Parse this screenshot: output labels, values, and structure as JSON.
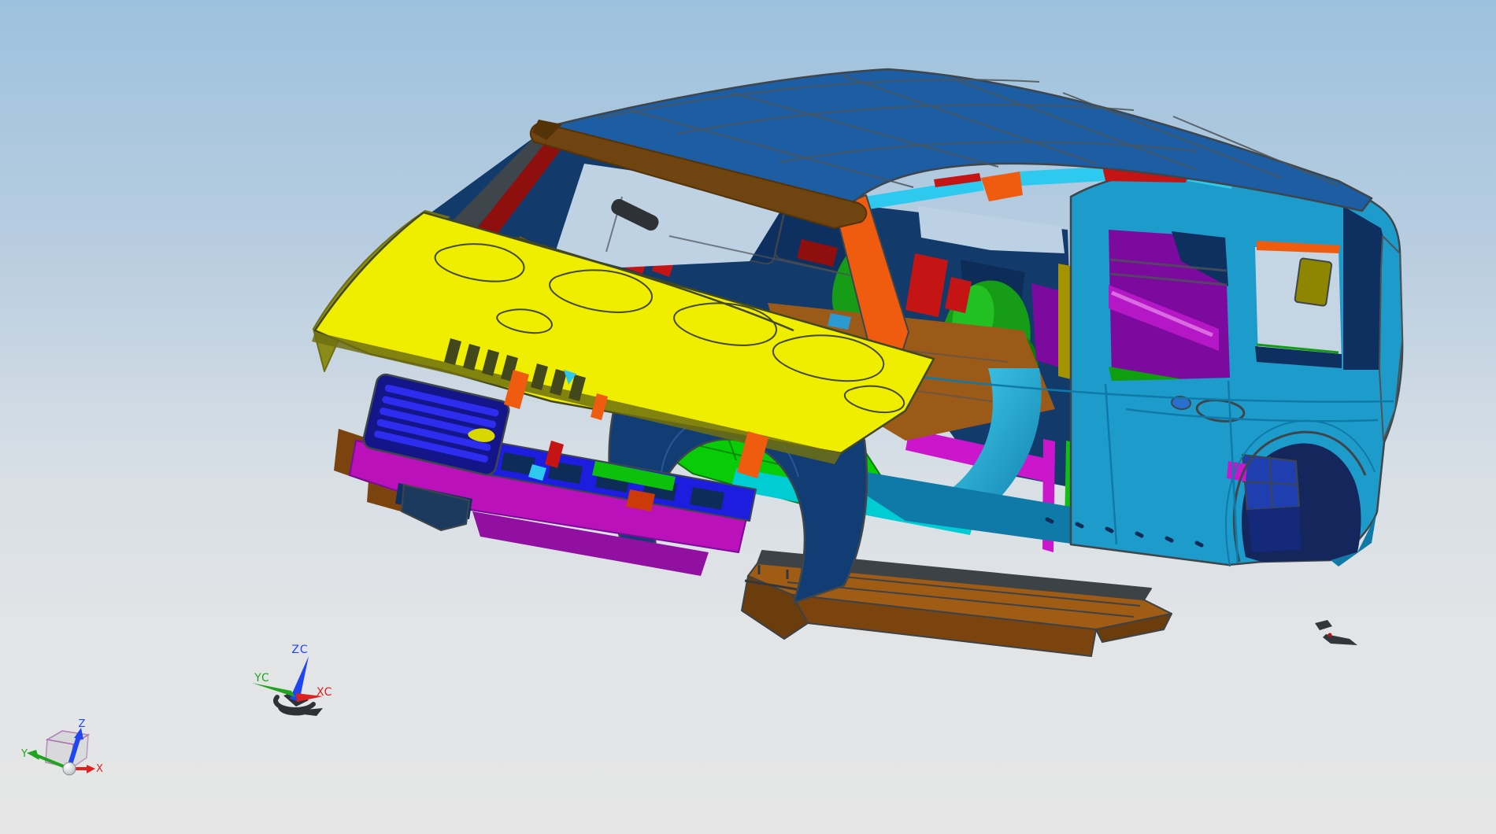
{
  "app": {
    "description": "CAD 3D viewport showing a body-in-white SUV model"
  },
  "viewport": {
    "triad_wcs": {
      "z_label": "ZC",
      "y_label": "YC",
      "x_label": "XC"
    },
    "triad_abs": {
      "z_label": "Z",
      "y_label": "Y",
      "x_label": "X"
    }
  },
  "palette": {
    "bg_top": "#9cc1de",
    "bg_upper": "#b9cde0",
    "bg_mid": "#d6dee5",
    "bg_lower": "#e2e4e6",
    "bg_bottom": "#e6e6e6",
    "sky_ws": "#bed2e4",
    "sky_door": "#bcd1e3",
    "sky_quarter": "#c6d5e3",
    "edge": "#3f464b",
    "seam": "#4c5357",
    "roof_blue": "#1c5da4",
    "roof_blue_dark": "#15497f",
    "header_brown": "#6f4410",
    "rail_brown_dark": "#553308",
    "hood_yellow": "#f0ee00",
    "hood_line": "#43481c",
    "olive": "#8b8b1a",
    "olive_dark": "#6e6e12",
    "olive_trim": "#8f8600",
    "teal_body": "#1d9ccc",
    "teal_light": "#3db4de",
    "teal_dark": "#0f7aa8",
    "cyan_accent": "#2ec9ee",
    "cyan_rocker": "#00ccd4",
    "navy_fender": "#123c74",
    "navy_dark": "#0d2c58",
    "int_blue": "#123a6b",
    "int_navy": "#0e3060",
    "orange": "#ef5c10",
    "red": "#c41414",
    "red_rust": "#cc3a0a",
    "dark_red": "#8f0e0e",
    "magenta": "#bb11bb",
    "magenta_bright": "#cc16cc",
    "purple": "#7c0b9a",
    "purple_shelf": "#7d0a9e",
    "magenta_tube": "#b517c6",
    "green_floor": "#07cc07",
    "green_seat": "#169c16",
    "green_dark": "#0a7a0a",
    "green_bright": "#10c010",
    "blue_grille": "#15158a",
    "blue_bright": "#2d2df0",
    "blue_cross": "#1d1de0",
    "blue_box": "#1f3fb0",
    "gold": "#a39300",
    "brown_floor": "#9c5a18",
    "brown_part": "#8a5014",
    "board_top": "#a05c14",
    "board_front": "#7b440e",
    "board_cap": "#6b3c0c",
    "board_rim": "#3d4246",
    "debris": "#33373b",
    "sphere_gray": "#e2e2e2",
    "cube_edge": "#a86aac",
    "cube_fill": "#d5d5d8",
    "axis_x": "#dd2020",
    "axis_y": "#21a321",
    "axis_z": "#1f46f0",
    "wcs_dark": "#2e3236"
  }
}
